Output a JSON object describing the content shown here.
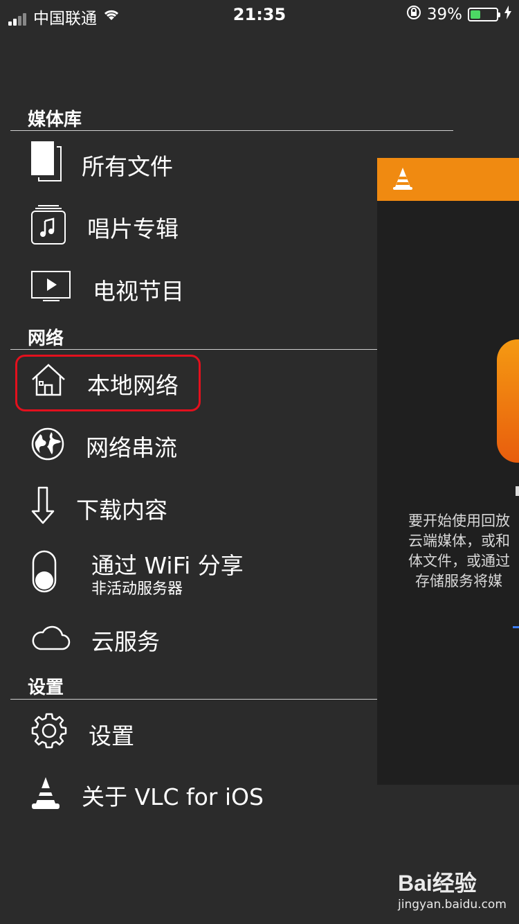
{
  "status_bar": {
    "carrier": "中国联通",
    "time": "21:35",
    "battery_percent": "39%",
    "battery_level": 0.39
  },
  "sections": {
    "media_library": "媒体库",
    "network": "网络",
    "settings": "设置"
  },
  "menu": {
    "all_files": "所有文件",
    "albums": "唱片专辑",
    "tv_shows": "电视节目",
    "local_network": "本地网络",
    "network_stream": "网络串流",
    "downloads": "下载内容",
    "wifi_share": "通过 WiFi 分享",
    "wifi_share_status": "非活动服务器",
    "cloud_services": "云服务",
    "settings": "设置",
    "about": "关于 VLC for iOS"
  },
  "background_panel": {
    "lines": [
      "要开始使用回放",
      "云端媒体，或和",
      "体文件，或通过",
      "存储服务将媒"
    ]
  },
  "watermark": {
    "brand": "Bai经验",
    "url": "jingyan.baidu.com"
  },
  "colors": {
    "background": "#2b2b2b",
    "accent_orange": "#f08a11",
    "highlight_red": "#e3101d",
    "battery_green": "#4cd964"
  }
}
